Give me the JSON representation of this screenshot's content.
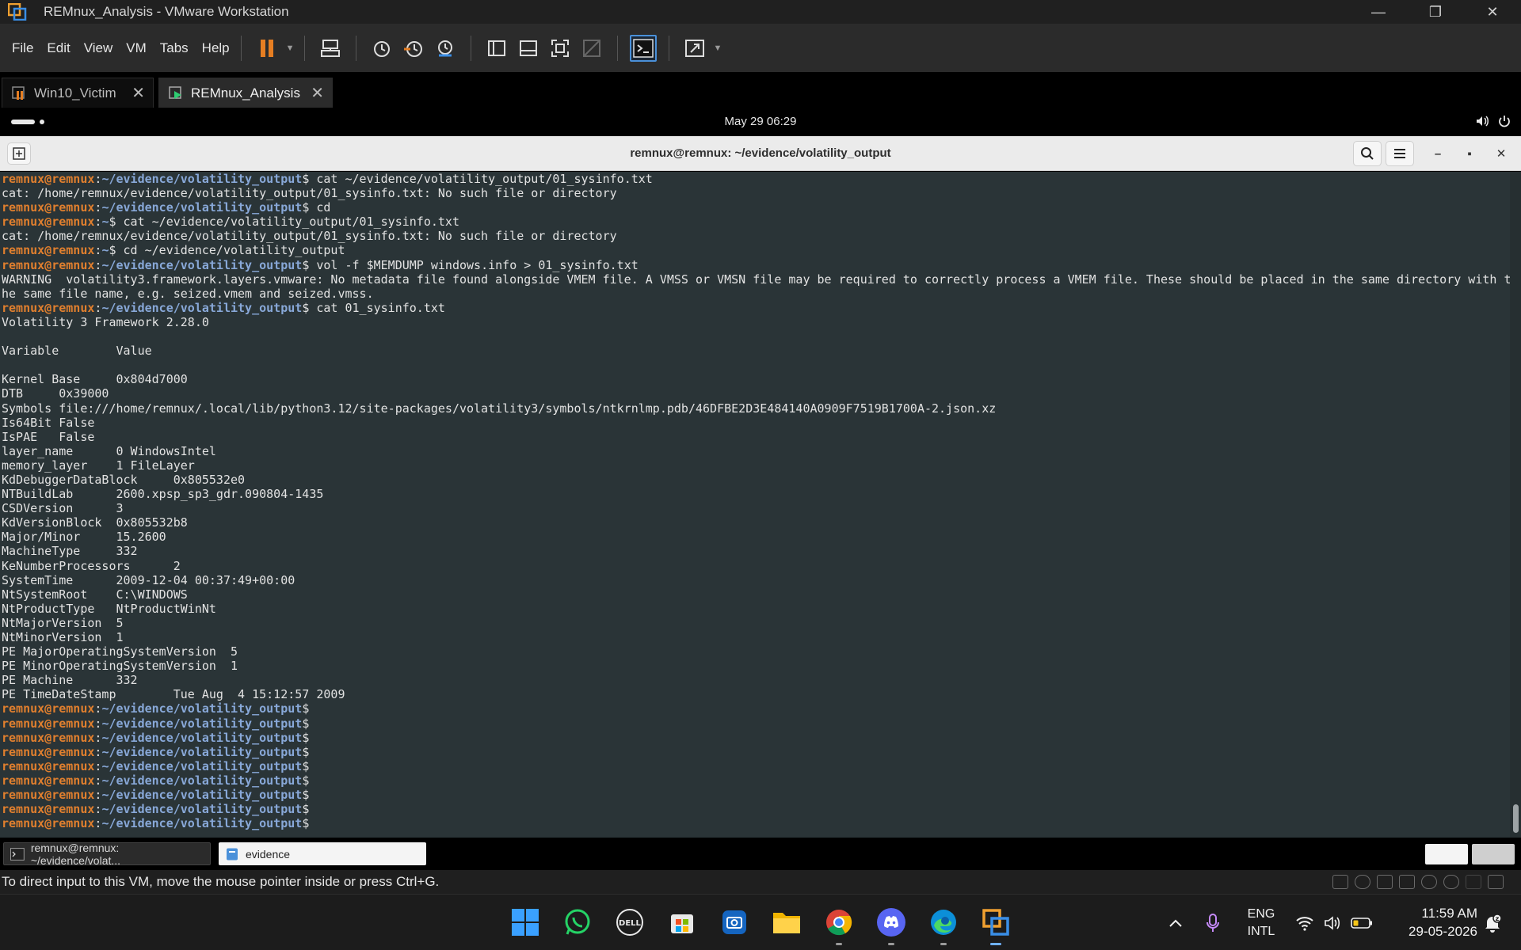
{
  "window": {
    "title": "REMnux_Analysis - VMware Workstation",
    "controls": {
      "minimize": "—",
      "restore": "❐",
      "close": "✕"
    }
  },
  "menubar": {
    "items": [
      "File",
      "Edit",
      "View",
      "VM",
      "Tabs",
      "Help"
    ]
  },
  "tabs": [
    {
      "label": "Win10_Victim",
      "active": false
    },
    {
      "label": "REMnux_Analysis",
      "active": true
    }
  ],
  "guest_topbar": {
    "clock": "May 29  06:29"
  },
  "terminal": {
    "title": "remnux@remnux: ~/evidence/volatility_output",
    "lines": [
      {
        "u": "remnux@remnux",
        "p": "~/evidence/volatility_output",
        "t": "$ cat ~/evidence/volatility_output/01_sysinfo.txt"
      },
      {
        "t": "cat: /home/remnux/evidence/volatility_output/01_sysinfo.txt: No such file or directory"
      },
      {
        "u": "remnux@remnux",
        "p": "~/evidence/volatility_output",
        "t": "$ cd"
      },
      {
        "u": "remnux@remnux",
        "p": "~",
        "t": "$ cat ~/evidence/volatility_output/01_sysinfo.txt"
      },
      {
        "t": "cat: /home/remnux/evidence/volatility_output/01_sysinfo.txt: No such file or directory"
      },
      {
        "u": "remnux@remnux",
        "p": "~",
        "t": "$ cd ~/evidence/volatility_output"
      },
      {
        "u": "remnux@remnux",
        "p": "~/evidence/volatility_output",
        "t": "$ vol -f $MEMDUMP windows.info > 01_sysinfo.txt"
      },
      {
        "t": "WARNING  volatility3.framework.layers.vmware: No metadata file found alongside VMEM file. A VMSS or VMSN file may be required to correctly process a VMEM file. These should be placed in the same directory with t"
      },
      {
        "t": "he same file name, e.g. seized.vmem and seized.vmss."
      },
      {
        "u": "remnux@remnux",
        "p": "~/evidence/volatility_output",
        "t": "$ cat 01_sysinfo.txt"
      },
      {
        "t": "Volatility 3 Framework 2.28.0"
      },
      {
        "t": ""
      },
      {
        "t": "Variable\tValue"
      },
      {
        "t": ""
      },
      {
        "t": "Kernel Base\t0x804d7000"
      },
      {
        "t": "DTB\t0x39000"
      },
      {
        "t": "Symbols\tfile:///home/remnux/.local/lib/python3.12/site-packages/volatility3/symbols/ntkrnlmp.pdb/46DFBE2D3E484140A0909F7519B1700A-2.json.xz"
      },
      {
        "t": "Is64Bit\tFalse"
      },
      {
        "t": "IsPAE\tFalse"
      },
      {
        "t": "layer_name\t0 WindowsIntel"
      },
      {
        "t": "memory_layer\t1 FileLayer"
      },
      {
        "t": "KdDebuggerDataBlock\t0x805532e0"
      },
      {
        "t": "NTBuildLab\t2600.xpsp_sp3_gdr.090804-1435"
      },
      {
        "t": "CSDVersion\t3"
      },
      {
        "t": "KdVersionBlock\t0x805532b8"
      },
      {
        "t": "Major/Minor\t15.2600"
      },
      {
        "t": "MachineType\t332"
      },
      {
        "t": "KeNumberProcessors\t2"
      },
      {
        "t": "SystemTime\t2009-12-04 00:37:49+00:00"
      },
      {
        "t": "NtSystemRoot\tC:\\WINDOWS"
      },
      {
        "t": "NtProductType\tNtProductWinNt"
      },
      {
        "t": "NtMajorVersion\t5"
      },
      {
        "t": "NtMinorVersion\t1"
      },
      {
        "t": "PE MajorOperatingSystemVersion\t5"
      },
      {
        "t": "PE MinorOperatingSystemVersion\t1"
      },
      {
        "t": "PE Machine\t332"
      },
      {
        "t": "PE TimeDateStamp\tTue Aug  4 15:12:57 2009"
      },
      {
        "u": "remnux@remnux",
        "p": "~/evidence/volatility_output",
        "t": "$"
      },
      {
        "u": "remnux@remnux",
        "p": "~/evidence/volatility_output",
        "t": "$"
      },
      {
        "u": "remnux@remnux",
        "p": "~/evidence/volatility_output",
        "t": "$"
      },
      {
        "u": "remnux@remnux",
        "p": "~/evidence/volatility_output",
        "t": "$"
      },
      {
        "u": "remnux@remnux",
        "p": "~/evidence/volatility_output",
        "t": "$"
      },
      {
        "u": "remnux@remnux",
        "p": "~/evidence/volatility_output",
        "t": "$"
      },
      {
        "u": "remnux@remnux",
        "p": "~/evidence/volatility_output",
        "t": "$"
      },
      {
        "u": "remnux@remnux",
        "p": "~/evidence/volatility_output",
        "t": "$"
      },
      {
        "u": "remnux@remnux",
        "p": "~/evidence/volatility_output",
        "t": "$"
      }
    ]
  },
  "guest_panel": {
    "tasks": [
      {
        "label": "remnux@remnux: ~/evidence/volat...",
        "active": false
      },
      {
        "label": "evidence",
        "active": true
      }
    ]
  },
  "statusbar": {
    "text": "To direct input to this VM, move the mouse pointer inside or press Ctrl+G."
  },
  "taskbar": {
    "lang_line1": "ENG",
    "lang_line2": "INTL",
    "time": "11:59 AM",
    "date": "29-05-2026"
  },
  "colors": {
    "terminal_bg": "#2a3437",
    "prompt_user": "#e07f2e",
    "prompt_path": "#88a8d8",
    "accent_orange": "#e67e22"
  }
}
